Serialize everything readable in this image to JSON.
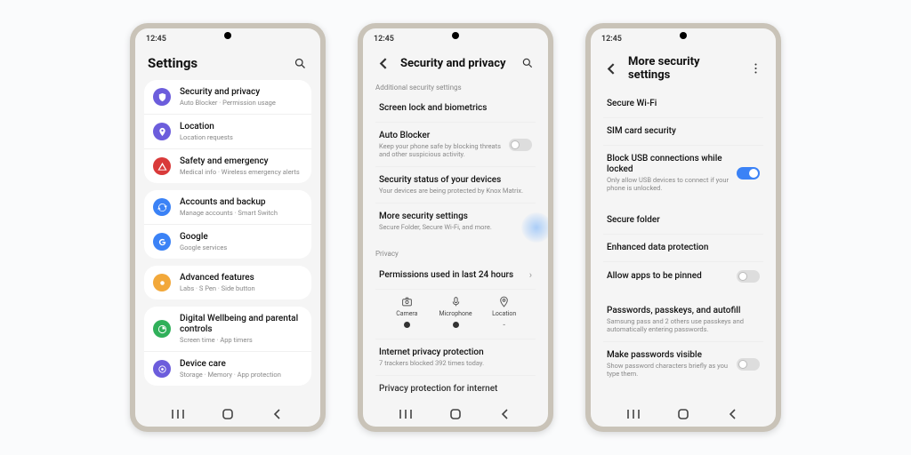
{
  "status_time": "12:45",
  "phone1": {
    "title": "Settings",
    "groups": [
      [
        {
          "icon": "shield",
          "color": "#6c5ddc",
          "title": "Security and privacy",
          "sub": "Auto Blocker · Permission usage"
        },
        {
          "icon": "pin",
          "color": "#6c5ddc",
          "title": "Location",
          "sub": "Location requests"
        },
        {
          "icon": "alert",
          "color": "#d93a3a",
          "title": "Safety and emergency",
          "sub": "Medical info · Wireless emergency alerts"
        }
      ],
      [
        {
          "icon": "sync",
          "color": "#3b82f6",
          "title": "Accounts and backup",
          "sub": "Manage accounts · Smart Switch"
        },
        {
          "icon": "google",
          "color": "#3b82f6",
          "title": "Google",
          "sub": "Google services"
        }
      ],
      [
        {
          "icon": "star",
          "color": "#f2a83a",
          "title": "Advanced features",
          "sub": "Labs · S Pen · Side button"
        }
      ],
      [
        {
          "icon": "wellbeing",
          "color": "#30b05a",
          "title": "Digital Wellbeing and parental controls",
          "sub": "Screen time · App timers"
        },
        {
          "icon": "device",
          "color": "#6c5ddc",
          "title": "Device care",
          "sub": "Storage · Memory · App protection"
        }
      ]
    ]
  },
  "phone2": {
    "title": "Security and privacy",
    "section1_label": "Additional security settings",
    "rows": [
      {
        "title": "Screen lock and biometrics"
      },
      {
        "title": "Auto Blocker",
        "sub": "Keep your phone safe by blocking threats and other suspicious activity.",
        "toggle": "off"
      },
      {
        "title": "Security status of your devices",
        "sub": "Your devices are being protected by Knox Matrix."
      },
      {
        "title": "More security settings",
        "sub": "Secure Folder, Secure Wi-Fi, and more.",
        "highlight": true
      }
    ],
    "privacy_label": "Privacy",
    "perm_row_title": "Permissions used in last 24 hours",
    "perms": [
      {
        "label": "Camera",
        "active": true
      },
      {
        "label": "Microphone",
        "active": true
      },
      {
        "label": "Location",
        "active": false
      }
    ],
    "rows2": [
      {
        "title": "Internet privacy protection",
        "sub": "7 trackers blocked 392 times today."
      },
      {
        "title": "Privacy protection for internet"
      }
    ]
  },
  "phone3": {
    "title": "More security settings",
    "rows_a": [
      {
        "title": "Secure Wi-Fi"
      },
      {
        "title": "SIM card security"
      },
      {
        "title": "Block USB connections while locked",
        "sub": "Only allow USB devices to connect if your phone is unlocked.",
        "toggle": "on"
      }
    ],
    "rows_b": [
      {
        "title": "Secure folder"
      },
      {
        "title": "Enhanced data protection"
      },
      {
        "title": "Allow apps to be pinned",
        "toggle": "off"
      }
    ],
    "rows_c": [
      {
        "title": "Passwords, passkeys, and autofill",
        "sub": "Samsung pass and 2 others use passkeys and automatically entering passwords."
      },
      {
        "title": "Make passwords visible",
        "sub": "Show password characters briefly as you type them.",
        "toggle": "off"
      }
    ]
  }
}
